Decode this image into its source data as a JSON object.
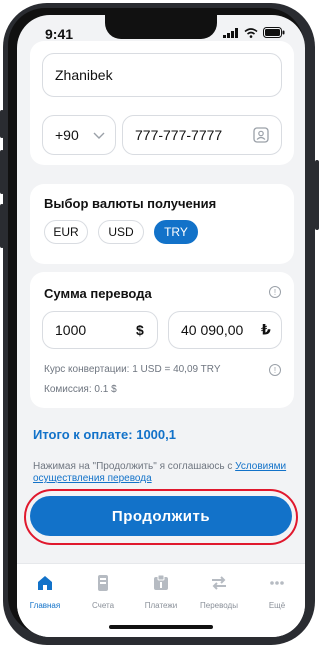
{
  "status_bar": {
    "time": "9:41"
  },
  "recipient": {
    "name_value": "Zhanibek",
    "phone_code": "+90",
    "phone_number": "777-777-7777"
  },
  "currency": {
    "title": "Выбор валюты получения",
    "options": [
      "EUR",
      "USD",
      "TRY"
    ],
    "selected": "TRY"
  },
  "amount": {
    "title": "Сумма перевода",
    "send_value": "1000",
    "send_currency_symbol": "$",
    "receive_value": "40 090,00",
    "receive_currency_symbol": "₺",
    "rate_text": "Курс конвертации: 1 USD = 40,09 TRY",
    "commission_text": "Комиссия: 0.1 $"
  },
  "total_text": "Итого к оплате: 1000,1",
  "agreement": {
    "prefix": "Нажимая на \"Продолжить\" я соглашаюсь с ",
    "link": "Условиями осуществления перевода"
  },
  "continue_label": "Продолжить",
  "tabbar": {
    "items": [
      {
        "label": "Главная",
        "icon": "home-icon",
        "active": true
      },
      {
        "label": "Счета",
        "icon": "accounts-icon",
        "active": false
      },
      {
        "label": "Платежи",
        "icon": "payments-icon",
        "active": false
      },
      {
        "label": "Переводы",
        "icon": "transfers-icon",
        "active": false
      },
      {
        "label": "Ещё",
        "icon": "more-icon",
        "active": false
      }
    ]
  },
  "colors": {
    "accent": "#1272c9",
    "highlight_ring": "#e0182d",
    "background": "#f2f3f5"
  }
}
